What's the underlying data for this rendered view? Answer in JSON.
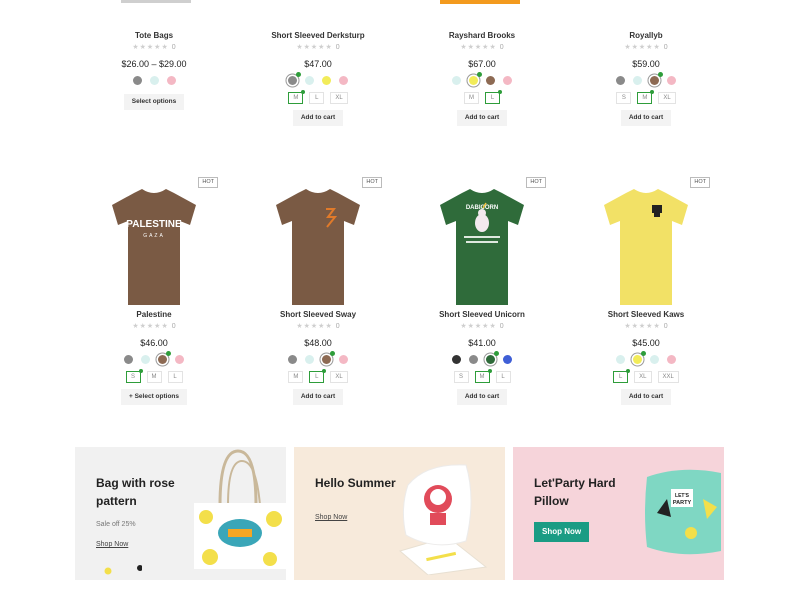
{
  "row1": [
    {
      "name": "Tote Bags",
      "rating_count": "0",
      "price": "$26.00 – $29.00",
      "colors": [
        {
          "hex": "#8a8a8a"
        },
        {
          "hex": "#d9f0ee"
        },
        {
          "hex": "#f4b8c4"
        }
      ],
      "sizes": [],
      "button": "Select options"
    },
    {
      "name": "Short Sleeved Derksturp",
      "rating_count": "0",
      "price": "$47.00",
      "colors": [
        {
          "hex": "#8a8a8a",
          "selected": true
        },
        {
          "hex": "#d9f0ee"
        },
        {
          "hex": "#f2ec5a"
        },
        {
          "hex": "#f4b8c4"
        }
      ],
      "sizes": [
        {
          "label": "M",
          "selected": true
        },
        {
          "label": "L"
        },
        {
          "label": "XL"
        }
      ],
      "button": "Add to cart"
    },
    {
      "name": "Rayshard Brooks",
      "rating_count": "0",
      "price": "$67.00",
      "colors": [
        {
          "hex": "#d9f0ee"
        },
        {
          "hex": "#f2ec5a",
          "selected": true
        },
        {
          "hex": "#8d6a53"
        },
        {
          "hex": "#f4b8c4"
        }
      ],
      "sizes": [
        {
          "label": "M"
        },
        {
          "label": "L",
          "selected": true
        }
      ],
      "button": "Add to cart"
    },
    {
      "name": "Royallyb",
      "rating_count": "0",
      "price": "$59.00",
      "colors": [
        {
          "hex": "#8a8a8a"
        },
        {
          "hex": "#d9f0ee"
        },
        {
          "hex": "#8d6a53",
          "selected": true
        },
        {
          "hex": "#f4b8c4"
        }
      ],
      "sizes": [
        {
          "label": "S"
        },
        {
          "label": "M",
          "selected": true
        },
        {
          "label": "XL"
        }
      ],
      "button": "Add to cart"
    }
  ],
  "row2": [
    {
      "name": "Palestine",
      "rating_count": "0",
      "price": "$46.00",
      "badge": "HOT",
      "shirt_color": "#7a5a44",
      "shirt_text": "PALESTINE",
      "shirt_subtext": "GAZA",
      "colors": [
        {
          "hex": "#8a8a8a"
        },
        {
          "hex": "#d9f0ee"
        },
        {
          "hex": "#8d6a53",
          "selected": true
        },
        {
          "hex": "#f4b8c4"
        }
      ],
      "sizes": [
        {
          "label": "S",
          "selected": true
        },
        {
          "label": "M"
        },
        {
          "label": "L"
        }
      ],
      "button": "+ Select options"
    },
    {
      "name": "Short Sleeved Sway",
      "rating_count": "0",
      "price": "$48.00",
      "badge": "HOT",
      "shirt_color": "#7a5a44",
      "colors": [
        {
          "hex": "#8a8a8a"
        },
        {
          "hex": "#d9f0ee"
        },
        {
          "hex": "#8d6a53",
          "selected": true
        },
        {
          "hex": "#f4b8c4"
        }
      ],
      "sizes": [
        {
          "label": "M"
        },
        {
          "label": "L",
          "selected": true
        },
        {
          "label": "XL"
        }
      ],
      "button": "Add to cart"
    },
    {
      "name": "Short Sleeved Unicorn",
      "rating_count": "0",
      "price": "$41.00",
      "badge": "HOT",
      "shirt_color": "#2f6b3a",
      "shirt_text": "DABICORN",
      "colors": [
        {
          "hex": "#333333"
        },
        {
          "hex": "#8a8a8a"
        },
        {
          "hex": "#2f6b3a",
          "selected": true
        },
        {
          "hex": "#3f5fd6"
        }
      ],
      "sizes": [
        {
          "label": "S"
        },
        {
          "label": "M",
          "selected": true
        },
        {
          "label": "L"
        }
      ],
      "button": "Add to cart"
    },
    {
      "name": "Short Sleeved Kaws",
      "rating_count": "0",
      "price": "$45.00",
      "badge": "HOT",
      "shirt_color": "#f2e166",
      "colors": [
        {
          "hex": "#d9f0ee"
        },
        {
          "hex": "#f2ec5a",
          "selected": true
        },
        {
          "hex": "#d9f0ee"
        },
        {
          "hex": "#f4b8c4"
        }
      ],
      "sizes": [
        {
          "label": "L",
          "selected": true
        },
        {
          "label": "XL"
        },
        {
          "label": "XXL"
        }
      ],
      "button": "Add to cart"
    }
  ],
  "banners": [
    {
      "title": "Bag with rose pattern",
      "subtitle": "Sale off 25%",
      "link": "Shop Now"
    },
    {
      "title": "Hello Summer",
      "link": "Shop Now"
    },
    {
      "title": "Let'Party Hard Pillow",
      "button": "Shop Now",
      "accent": "#1a9c84"
    }
  ]
}
